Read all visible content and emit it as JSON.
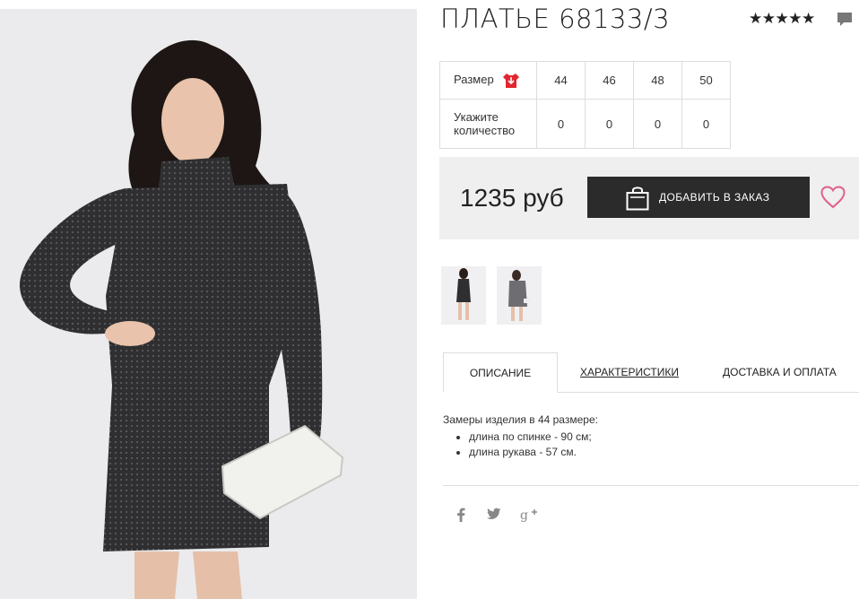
{
  "product": {
    "title": "ПЛАТЬЕ 68133/3",
    "rating_stars": "★★★★★",
    "price": "1235 руб"
  },
  "sizes": {
    "header_label": "Размер",
    "quantity_label_line1": "Укажите",
    "quantity_label_line2": "количество",
    "values": [
      "44",
      "46",
      "48",
      "50"
    ],
    "quantities": [
      "0",
      "0",
      "0",
      "0"
    ]
  },
  "actions": {
    "order_button": "ДОБАВИТЬ В ЗАКАЗ"
  },
  "tabs": {
    "description": "ОПИСАНИЕ",
    "characteristics": "ХАРАКТЕРИСТИКИ",
    "delivery": "ДОСТАВКА И ОПЛАТА"
  },
  "description": {
    "intro": "Замеры изделия в 44 размере:",
    "items": [
      "длина по спинке - 90 см;",
      "длина рукава - 57 см."
    ]
  },
  "social": {
    "facebook": "f",
    "twitter": "t",
    "google": "g+"
  },
  "colors": {
    "dress": "#2f2f31",
    "button": "#2b2b2b",
    "heart": "#e0608a",
    "size_icon": "#e3262f"
  },
  "icons": [
    "comment-icon",
    "size-chart-icon",
    "bag-icon",
    "heart-icon",
    "facebook-icon",
    "twitter-icon",
    "google-plus-icon"
  ]
}
